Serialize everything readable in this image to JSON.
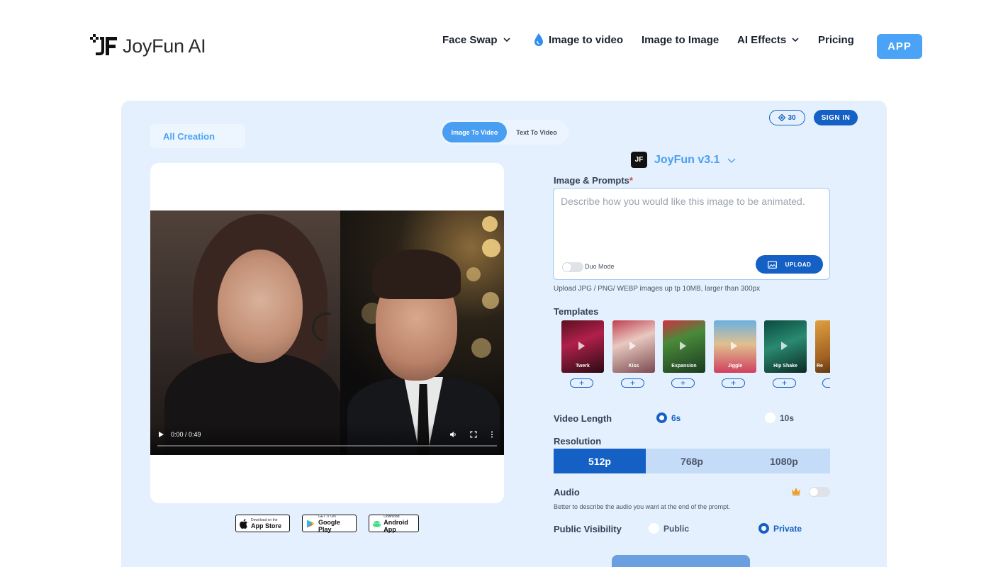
{
  "header": {
    "logo_text": "JoyFun AI",
    "nav": {
      "face_swap": "Face Swap",
      "image_to_video": "Image to video",
      "image_to_image": "Image to Image",
      "ai_effects": "AI Effects",
      "pricing": "Pricing"
    },
    "app_button": "APP"
  },
  "account": {
    "credits": "30",
    "sign_in": "SIGN IN"
  },
  "left": {
    "all_creation": "All Creation",
    "video": {
      "time": "0:00 / 0:49"
    },
    "stores": [
      {
        "small": "Download on the",
        "big": "App Store"
      },
      {
        "small": "GET IT ON",
        "big": "Google Play"
      },
      {
        "small": "Download",
        "big": "Android App"
      }
    ]
  },
  "mode_tabs": {
    "image_to_video": "Image To Video",
    "text_to_video": "Text To Video"
  },
  "form": {
    "model": {
      "logo": "JF",
      "name": "JoyFun v3.1"
    },
    "prompt_label": "Image & Prompts",
    "prompt_required": "*",
    "prompt_placeholder": "Describe how you would like this image to be animated.",
    "duo_mode": "Duo Mode",
    "upload": "UPLOAD",
    "upload_hint": "Upload JPG / PNG/ WEBP images up tp 10MB, larger than 300px",
    "templates_label": "Templates",
    "templates": [
      "Twerk",
      "Kiss",
      "Expansion",
      "Jiggle",
      "Hip Shake",
      "Re"
    ],
    "video_length_label": "Video Length",
    "video_length_options": [
      "6s",
      "10s"
    ],
    "video_length_selected": "6s",
    "resolution_label": "Resolution",
    "resolution_options": [
      "512p",
      "768p",
      "1080p"
    ],
    "resolution_selected": "512p",
    "audio_label": "Audio",
    "audio_hint": "Better to describe the audio you want at the end of the prompt.",
    "visibility_label": "Public Visibility",
    "visibility_options": [
      "Public",
      "Private"
    ],
    "visibility_selected": "Private"
  },
  "colors": {
    "accent": "#4a9ef2",
    "primary": "#1560c4",
    "panel_bg": "#e4f0fd"
  }
}
